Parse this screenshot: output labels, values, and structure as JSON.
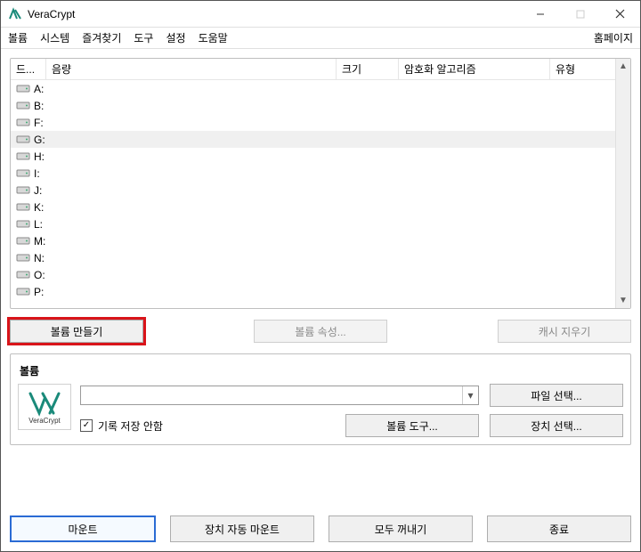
{
  "titlebar": {
    "title": "VeraCrypt"
  },
  "menu": {
    "items": [
      "볼륨",
      "시스템",
      "즐겨찾기",
      "도구",
      "설정",
      "도움말"
    ],
    "homepage": "홈페이지"
  },
  "list": {
    "headers": {
      "drive": "드...",
      "volume": "음량",
      "size": "크기",
      "algo": "암호화 알고리즘",
      "type": "유형"
    },
    "drives": [
      "A:",
      "B:",
      "F:",
      "G:",
      "H:",
      "I:",
      "J:",
      "K:",
      "L:",
      "M:",
      "N:",
      "O:",
      "P:"
    ],
    "selected_index": 3
  },
  "midbtns": {
    "create": "볼륨 만들기",
    "props": "볼륨 속성...",
    "clearcache": "캐시 지우기"
  },
  "volsection": {
    "label": "볼륨",
    "logo_sub": "VeraCrypt",
    "combo_value": "",
    "nohistory": "기록 저장 안함",
    "selectfile": "파일 선택...",
    "tools": "볼륨 도구...",
    "selectdevice": "장치 선택..."
  },
  "bottom": {
    "mount": "마운트",
    "automount": "장치 자동 마운트",
    "dismountall": "모두 꺼내기",
    "exit": "종료"
  }
}
